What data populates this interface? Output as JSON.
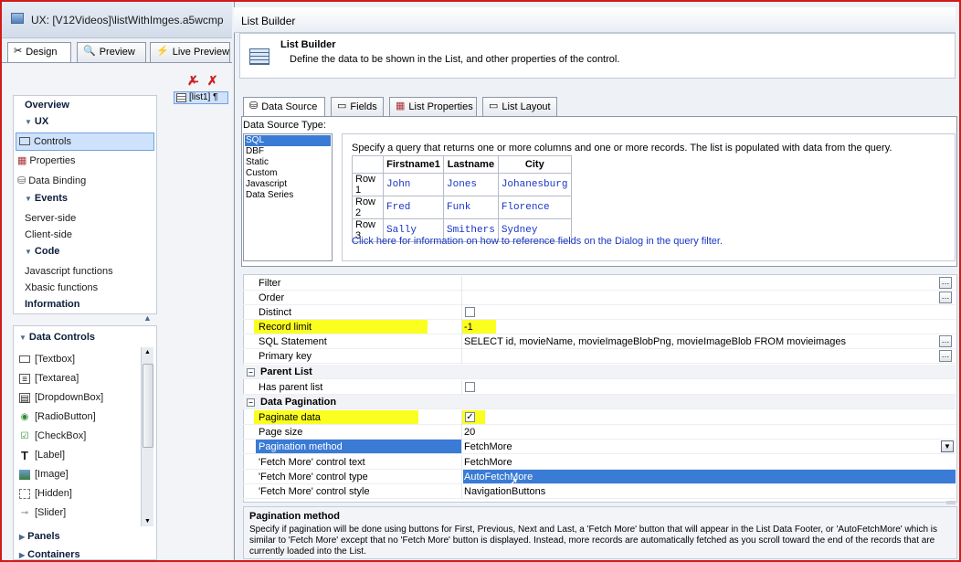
{
  "window": {
    "title": "UX: [V12Videos]\\listWithImges.a5wcmp",
    "tabs": [
      {
        "label": "Design",
        "icon": "design-icon"
      },
      {
        "label": "Preview",
        "icon": "preview-icon"
      },
      {
        "label": "Live Preview",
        "icon": "lightning-icon"
      }
    ]
  },
  "nav": {
    "items": [
      {
        "label": "Overview",
        "type": "header"
      },
      {
        "label": "UX",
        "type": "group"
      },
      {
        "label": "Controls",
        "type": "item",
        "selected": true,
        "icon": "controls-icon"
      },
      {
        "label": "Properties",
        "type": "item",
        "icon": "properties-icon"
      },
      {
        "label": "Data Binding",
        "type": "item",
        "icon": "database-icon"
      },
      {
        "label": "Events",
        "type": "group"
      },
      {
        "label": "Server-side",
        "type": "item"
      },
      {
        "label": "Client-side",
        "type": "item"
      },
      {
        "label": "Code",
        "type": "group"
      },
      {
        "label": "Javascript functions",
        "type": "item"
      },
      {
        "label": "Xbasic functions",
        "type": "item"
      },
      {
        "label": "Information",
        "type": "header"
      }
    ]
  },
  "controls": {
    "header": "Data Controls",
    "items": [
      {
        "label": "[Textbox]",
        "icon": "textbox-icon"
      },
      {
        "label": "[Textarea]",
        "icon": "textarea-icon"
      },
      {
        "label": "[DropdownBox]",
        "icon": "dropdown-icon"
      },
      {
        "label": "[RadioButton]",
        "icon": "radio-icon"
      },
      {
        "label": "[CheckBox]",
        "icon": "checkbox-icon"
      },
      {
        "label": "[Label]",
        "icon": "label-icon"
      },
      {
        "label": "[Image]",
        "icon": "image-icon"
      },
      {
        "label": "[Hidden]",
        "icon": "hidden-icon"
      },
      {
        "label": "[Slider]",
        "icon": "slider-icon"
      }
    ],
    "groups": [
      "Panels",
      "Containers"
    ]
  },
  "canvas": {
    "item": "[list1] ¶"
  },
  "dialog": {
    "title": "List Builder",
    "header_title": "List Builder",
    "header_desc": "Define the data to be shown in the List, and other properties of the control.",
    "tabs": [
      {
        "label": "Data Source",
        "icon": "database-icon",
        "active": true
      },
      {
        "label": "Fields",
        "icon": "fields-icon"
      },
      {
        "label": "List Properties",
        "icon": "list-properties-icon"
      },
      {
        "label": "List Layout",
        "icon": "list-layout-icon"
      }
    ],
    "ds_type_label": "Data Source Type:",
    "ds_types": [
      "SQL",
      "DBF",
      "Static",
      "Custom",
      "Javascript",
      "Data Series"
    ],
    "ds_selected": "SQL",
    "query_text": "Specify a query that returns one or more columns and one or more records. The list is populated with data from the query.",
    "sample": {
      "headers": [
        "",
        "Firstname1",
        "Lastname",
        "City"
      ],
      "rows": [
        [
          "Row 1",
          "John",
          "Jones",
          "Johanesburg"
        ],
        [
          "Row 2",
          "Fred",
          "Funk",
          "Florence"
        ],
        [
          "Row 3",
          "Sally",
          "Smithers",
          "Sydney"
        ]
      ]
    },
    "link": "Click here for information on how to reference fields on the Dialog in the query filter."
  },
  "props": {
    "filter": {
      "name": "Filter",
      "value": ""
    },
    "order": {
      "name": "Order",
      "value": ""
    },
    "distinct": {
      "name": "Distinct",
      "value": ""
    },
    "record_limit": {
      "name": "Record limit",
      "value": "-1"
    },
    "sql": {
      "name": "SQL Statement",
      "value": "SELECT id, movieName, movieImageBlobPng, movieImageBlob FROM movieimages"
    },
    "primary_key": {
      "name": "Primary key",
      "value": ""
    },
    "cat_parent": "Parent List",
    "has_parent": {
      "name": "Has parent list",
      "value": ""
    },
    "cat_pagination": "Data Pagination",
    "paginate": {
      "name": "Paginate data",
      "value": "✓"
    },
    "page_size": {
      "name": "Page size",
      "value": "20"
    },
    "pag_method": {
      "name": "Pagination method",
      "value": "FetchMore"
    },
    "fm_text": {
      "name": "'Fetch More' control text",
      "value": "FetchMore"
    },
    "fm_type": {
      "name": "'Fetch More' control type",
      "value": "AutoFetchMore"
    },
    "fm_style": {
      "name": "'Fetch More' control style",
      "value": "NavigationButtons"
    }
  },
  "desc": {
    "title": "Pagination method",
    "text": "Specify if pagination will be done using buttons for First, Previous, Next and Last, a 'Fetch More' button that will appear in the List Data Footer, or 'AutoFetchMore' which is similar to 'Fetch More' except that no 'Fetch More' button is displayed. Instead, more records are automatically fetched as you scroll toward the end of the records that are currently loaded into the List."
  },
  "colors": {
    "highlight": "#fbff20",
    "selection": "#3a7bd5",
    "border": "#d21a1a"
  }
}
